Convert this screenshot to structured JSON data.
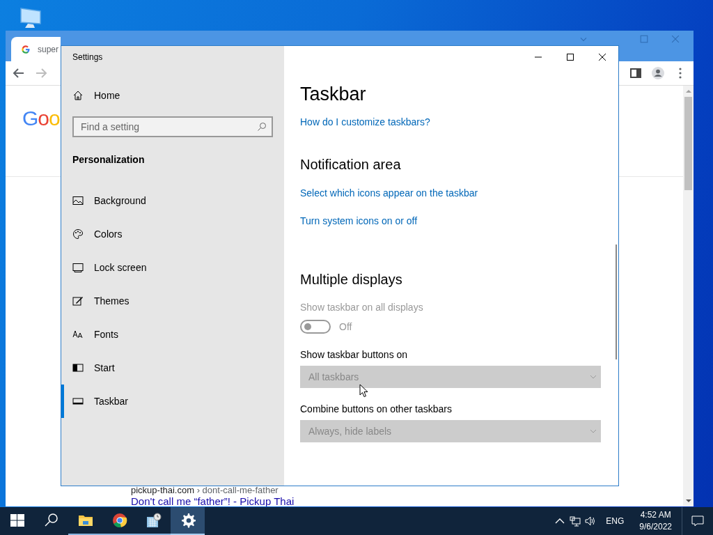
{
  "browser": {
    "tab_title": "super",
    "logo": "Goo",
    "result": {
      "site": "pickup-thai.com",
      "path": "› dont-call-me-father",
      "title": "Don't call me “father”! - Pickup Thai"
    }
  },
  "settings": {
    "title": "Settings",
    "home": "Home",
    "search": {
      "placeholder": "Find a setting"
    },
    "section": "Personalization",
    "nav": [
      {
        "kind": "picture",
        "label": "Background",
        "selected": false
      },
      {
        "kind": "palette",
        "label": "Colors",
        "selected": false
      },
      {
        "kind": "monitor",
        "label": "Lock screen",
        "selected": false
      },
      {
        "kind": "brush",
        "label": "Themes",
        "selected": false
      },
      {
        "kind": "font",
        "label": "Fonts",
        "selected": false
      },
      {
        "kind": "start",
        "label": "Start",
        "selected": false
      },
      {
        "kind": "taskbar",
        "label": "Taskbar",
        "selected": true
      }
    ],
    "page_title": "Taskbar",
    "help_link": "How do I customize taskbars?",
    "groups": [
      {
        "heading": "Notification area",
        "items": [
          {
            "kind": "link",
            "text": "Select which icons appear on the taskbar"
          },
          {
            "kind": "link",
            "text": "Turn system icons on or off"
          }
        ]
      },
      {
        "heading": "Multiple displays",
        "items": [
          {
            "kind": "toggle",
            "label": "Show taskbar on all displays",
            "on": false,
            "state_text": "Off",
            "disabled": true
          },
          {
            "kind": "dropdown",
            "label": "Show taskbar buttons on",
            "value": "All taskbars",
            "disabled": true
          },
          {
            "kind": "dropdown",
            "label": "Combine buttons on other taskbars",
            "value": "Always, hide labels",
            "disabled": true
          }
        ]
      }
    ]
  },
  "taskbar": {
    "apps": [
      {
        "kind": "start",
        "running": false,
        "active": false
      },
      {
        "kind": "search",
        "running": false,
        "active": false
      },
      {
        "kind": "folder",
        "running": true,
        "active": false
      },
      {
        "kind": "chrome",
        "running": true,
        "active": false
      },
      {
        "kind": "calendar",
        "running": true,
        "active": false
      },
      {
        "kind": "gear",
        "running": true,
        "active": true
      }
    ],
    "language": "ENG",
    "time": "4:52 AM",
    "date": "9/6/2022"
  }
}
